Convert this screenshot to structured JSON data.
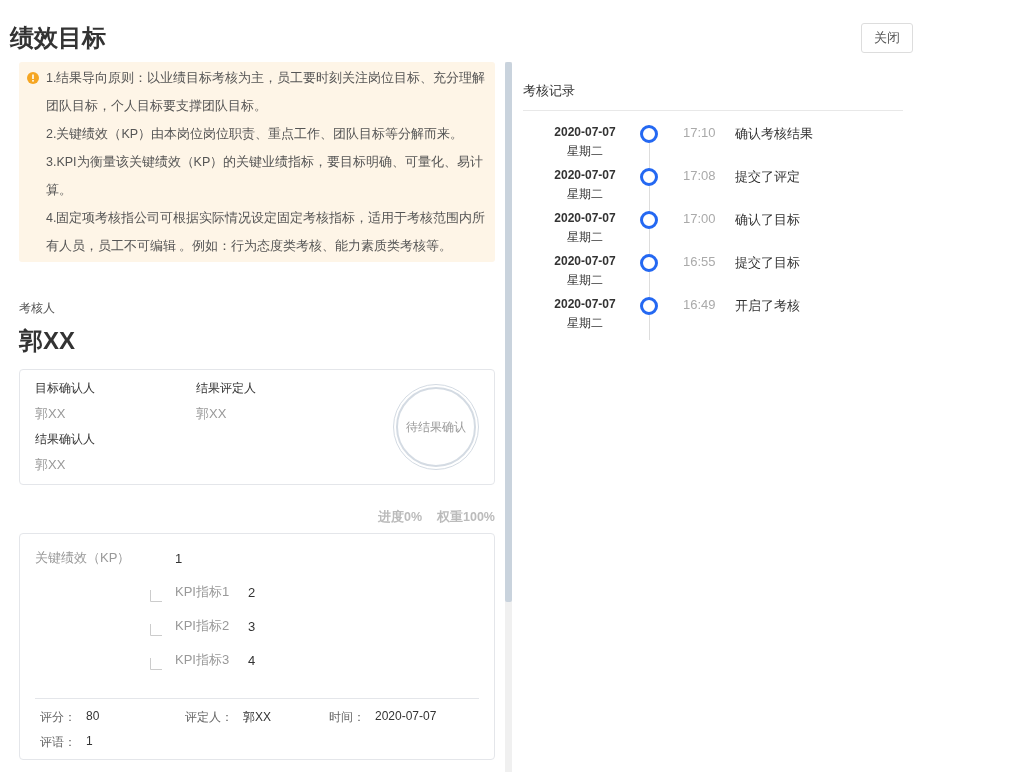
{
  "title": "绩效目标",
  "close_button": "关闭",
  "notice": {
    "paragraphs": [
      "1.结果导向原则：以业绩目标考核为主，员工要时刻关注岗位目标、充分理解团队目标，个人目标要支撑团队目标。",
      "2.关键绩效（KP）由本岗位岗位职责、重点工作、团队目标等分解而来。",
      "3.KPI为衡量该关键绩效（KP）的关键业绩指标，要目标明确、可量化、易计算。",
      "4.固定项考核指公司可根据实际情况设定固定考核指标，适用于考核范围内所有人员，员工不可编辑 。例如：行为态度类考核、能力素质类考核等。"
    ]
  },
  "reviewer": {
    "label": "考核人",
    "name": "郭XX"
  },
  "approvers": [
    {
      "label": "目标确认人",
      "name": "郭XX"
    },
    {
      "label": "结果评定人",
      "name": "郭XX"
    },
    {
      "label": "结果确认人",
      "name": "郭XX"
    }
  ],
  "stamp": "待结果确认",
  "progress": "进度0%",
  "weight": "权重100%",
  "kp": {
    "label": "关键绩效（KP）",
    "value": "1",
    "kpis": [
      {
        "label": "KPI指标1",
        "value": "2"
      },
      {
        "label": "KPI指标2",
        "value": "3"
      },
      {
        "label": "KPI指标3",
        "value": "4"
      }
    ]
  },
  "result": {
    "score_label": "评分：",
    "score": "80",
    "rater_label": "评定人：",
    "rater": "郭XX",
    "time_label": "时间：",
    "time": "2020-07-07",
    "comment_label": "评语：",
    "comment": "1"
  },
  "records": {
    "title": "考核记录",
    "items": [
      {
        "date": "2020-07-07",
        "weekday": "星期二",
        "time": "17:10",
        "action": "确认考核结果"
      },
      {
        "date": "2020-07-07",
        "weekday": "星期二",
        "time": "17:08",
        "action": "提交了评定"
      },
      {
        "date": "2020-07-07",
        "weekday": "星期二",
        "time": "17:00",
        "action": "确认了目标"
      },
      {
        "date": "2020-07-07",
        "weekday": "星期二",
        "time": "16:55",
        "action": "提交了目标"
      },
      {
        "date": "2020-07-07",
        "weekday": "星期二",
        "time": "16:49",
        "action": "开启了考核"
      }
    ]
  }
}
